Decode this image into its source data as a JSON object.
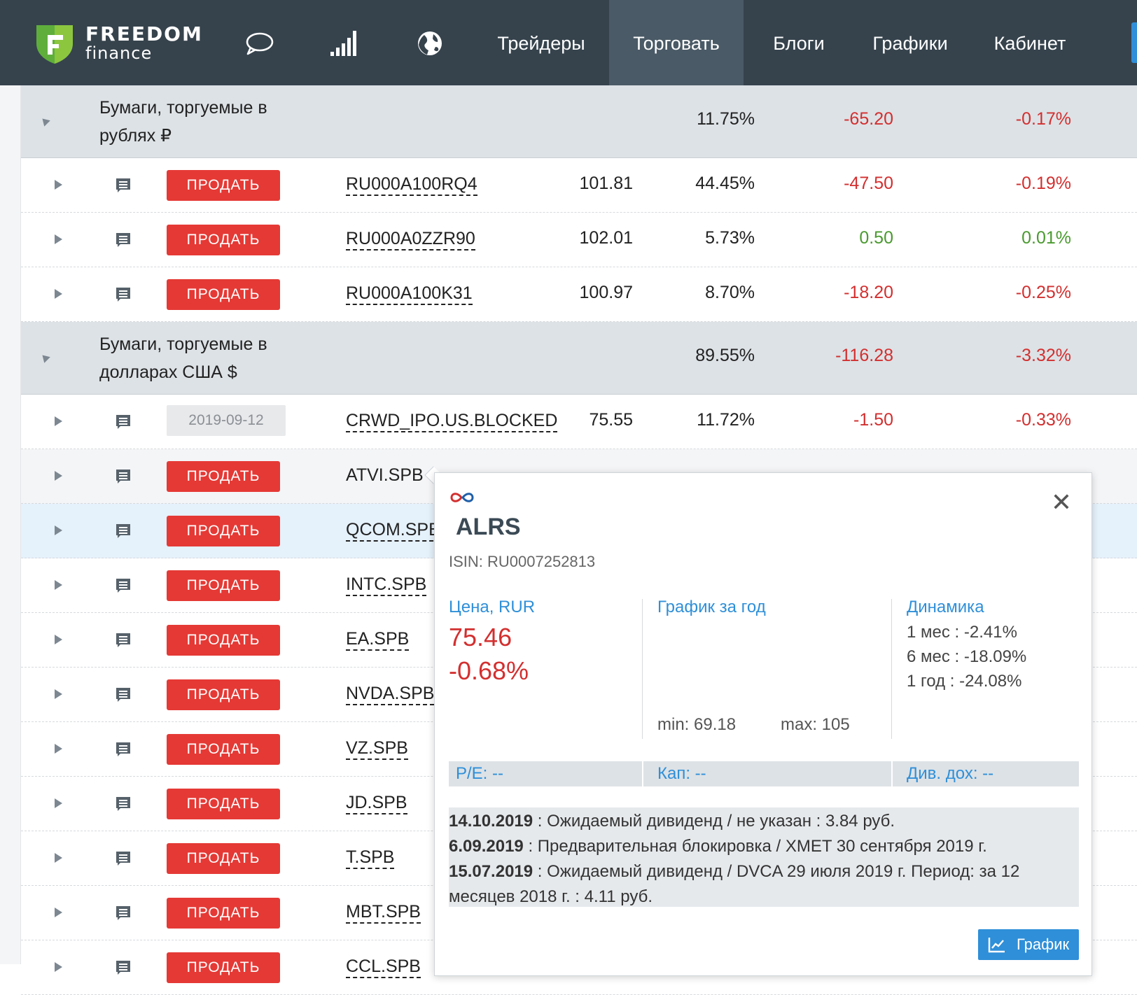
{
  "header": {
    "brand_top": "FREEDOM",
    "brand_bottom": "finance",
    "icons": [
      "chat-bubble-icon",
      "signal-bars-icon",
      "globe-icon"
    ],
    "nav": [
      {
        "label": "Трейдеры",
        "active": false
      },
      {
        "label": "Торговать",
        "active": true
      },
      {
        "label": "Блоги",
        "active": false
      },
      {
        "label": "Графики",
        "active": false
      },
      {
        "label": "Кабинет",
        "active": false
      }
    ]
  },
  "groups": [
    {
      "title": "Бумаги, торгуемые в рублях ₽",
      "share": "11.75%",
      "pl": "-65.20",
      "pct": "-0.17%",
      "rows": [
        {
          "button": "ПРОДАТЬ",
          "ticker": "RU000A100RQ4",
          "price": "101.81",
          "share": "44.45%",
          "pl": "-47.50",
          "pct": "-0.19%"
        },
        {
          "button": "ПРОДАТЬ",
          "ticker": "RU000A0ZZR90",
          "price": "102.01",
          "share": "5.73%",
          "pl": "0.50",
          "pct": "0.01%"
        },
        {
          "button": "ПРОДАТЬ",
          "ticker": "RU000A100K31",
          "price": "100.97",
          "share": "8.70%",
          "pl": "-18.20",
          "pct": "-0.25%"
        }
      ]
    },
    {
      "title": "Бумаги, торгуемые в долларах США $",
      "share": "89.55%",
      "pl": "-116.28",
      "pct": "-3.32%",
      "rows": [
        {
          "date": "2019-09-12",
          "ticker": "CRWD_IPO.US.BLOCKED",
          "price": "75.55",
          "share": "11.72%",
          "pl": "-1.50",
          "pct": "-0.33%"
        },
        {
          "button": "ПРОДАТЬ",
          "ticker": "ATVI.SPB"
        },
        {
          "button": "ПРОДАТЬ",
          "ticker": "QCOM.SPB"
        },
        {
          "button": "ПРОДАТЬ",
          "ticker": "INTC.SPB"
        },
        {
          "button": "ПРОДАТЬ",
          "ticker": "EA.SPB"
        },
        {
          "button": "ПРОДАТЬ",
          "ticker": "NVDA.SPB"
        },
        {
          "button": "ПРОДАТЬ",
          "ticker": "VZ.SPB"
        },
        {
          "button": "ПРОДАТЬ",
          "ticker": "JD.SPB"
        },
        {
          "button": "ПРОДАТЬ",
          "ticker": "T.SPB"
        },
        {
          "button": "ПРОДАТЬ",
          "ticker": "MBT.SPB"
        },
        {
          "button": "ПРОДАТЬ",
          "ticker": "CCL.SPB"
        }
      ]
    }
  ],
  "popup": {
    "ticker": "ALRS",
    "isin": "ISIN: RU0007252813",
    "price_label": "Цена, RUR",
    "price": "75.46",
    "change": "-0.68%",
    "chart_label": "График за год",
    "min": "min: 69.18",
    "max": "max: 105",
    "dynamics_label": "Динамика",
    "dynamics": [
      {
        "period": "1 мес :",
        "value": "-2.41%"
      },
      {
        "period": "6 мес :",
        "value": "-18.09%"
      },
      {
        "period": "1 год :",
        "value": "-24.08%"
      }
    ],
    "pe": "P/E:  --",
    "cap": "Кап:  --",
    "div": "Див. дох:  --",
    "events": [
      {
        "date": "14.10.2019",
        "text": " : Ожидаемый дивиденд / не указан : 3.84 руб."
      },
      {
        "date": "6.09.2019",
        "text": " : Предварительная блокировка / XMET 30 сентября 2019 г."
      },
      {
        "date": "15.07.2019",
        "text": " : Ожидаемый дивиденд / DVCA 29 июля 2019 г. Период: за 12 месяцев 2018 г. : 4.11 руб."
      }
    ],
    "graph_button": "График"
  },
  "colors": {
    "header_bg": "#36434d",
    "sell_red": "#e53935",
    "negative": "#d32f2f",
    "positive": "#4a9a2f",
    "accent_blue": "#2f8fd8"
  }
}
